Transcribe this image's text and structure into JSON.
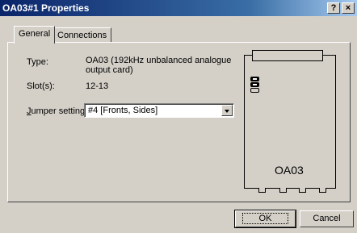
{
  "window": {
    "title": "OA03#1 Properties",
    "help_label": "?",
    "close_label": "×"
  },
  "tabs": [
    {
      "label": "General",
      "active": true
    },
    {
      "label": "Connections",
      "active": false
    }
  ],
  "general": {
    "type_label": "Type:",
    "type_value_line1": "OA03 (192kHz unbalanced analogue",
    "type_value_line2": "output card)",
    "slot_label": "Slot(s):",
    "slot_value": "12-13",
    "jumper_label_accesskey": "J",
    "jumper_label_rest": "umper setting:",
    "jumper_value": "#4 [Fronts, Sides]"
  },
  "card": {
    "name": "OA03",
    "jumpers": [
      true,
      true,
      false
    ]
  },
  "buttons": {
    "ok_label": "OK",
    "cancel_label": "Cancel"
  }
}
